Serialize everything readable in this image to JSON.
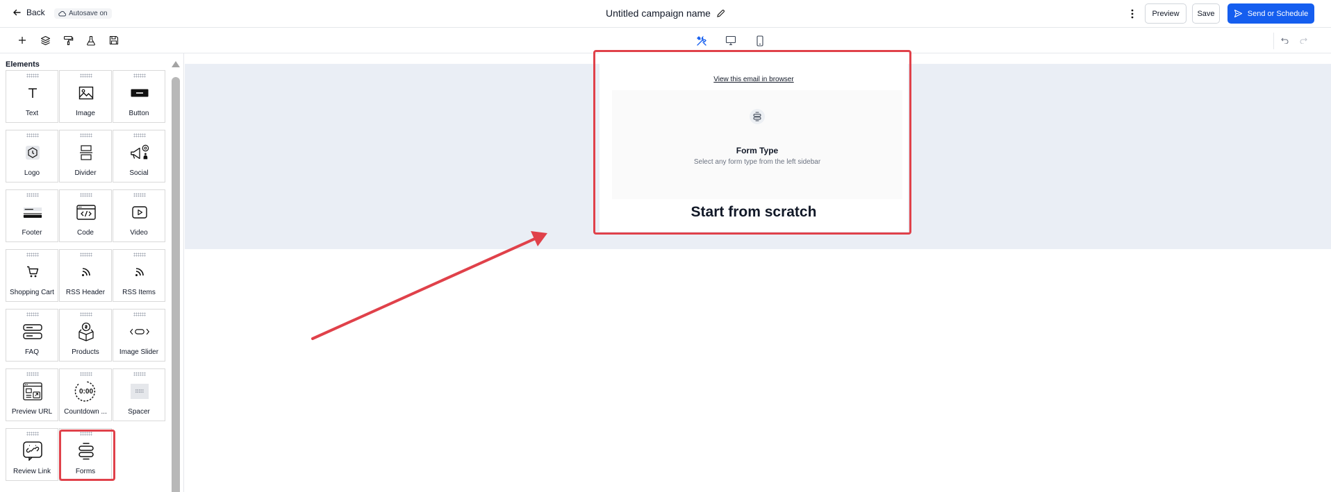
{
  "header": {
    "back_label": "Back",
    "autosave_label": "Autosave on",
    "campaign_name": "Untitled campaign name",
    "preview_label": "Preview",
    "save_label": "Save",
    "send_label": "Send or Schedule"
  },
  "sidebar": {
    "title": "Elements",
    "items": [
      {
        "label": "Text",
        "icon": "text-icon"
      },
      {
        "label": "Image",
        "icon": "image-icon"
      },
      {
        "label": "Button",
        "icon": "button-icon"
      },
      {
        "label": "Logo",
        "icon": "logo-icon"
      },
      {
        "label": "Divider",
        "icon": "divider-icon"
      },
      {
        "label": "Social",
        "icon": "social-icon"
      },
      {
        "label": "Footer",
        "icon": "footer-icon"
      },
      {
        "label": "Code",
        "icon": "code-icon"
      },
      {
        "label": "Video",
        "icon": "video-icon"
      },
      {
        "label": "Shopping Cart",
        "icon": "cart-icon"
      },
      {
        "label": "RSS Header",
        "icon": "rss-icon"
      },
      {
        "label": "RSS Items",
        "icon": "rss-icon"
      },
      {
        "label": "FAQ",
        "icon": "faq-icon"
      },
      {
        "label": "Products",
        "icon": "products-icon"
      },
      {
        "label": "Image Slider",
        "icon": "slider-icon"
      },
      {
        "label": "Preview URL",
        "icon": "preview-url-icon"
      },
      {
        "label": "Countdown ...",
        "icon": "countdown-icon",
        "icon_text": "0:00"
      },
      {
        "label": "Spacer",
        "icon": "spacer-icon"
      },
      {
        "label": "Review Link",
        "icon": "review-link-icon"
      },
      {
        "label": "Forms",
        "icon": "forms-icon"
      }
    ]
  },
  "canvas": {
    "view_link": "View this email in browser",
    "form_title": "Form Type",
    "form_subtitle": "Select any form type from the left sidebar",
    "scratch_heading": "Start from scratch"
  },
  "colors": {
    "primary": "#155eef",
    "highlight": "#e0414a",
    "canvas_bg": "#eaeef5"
  }
}
